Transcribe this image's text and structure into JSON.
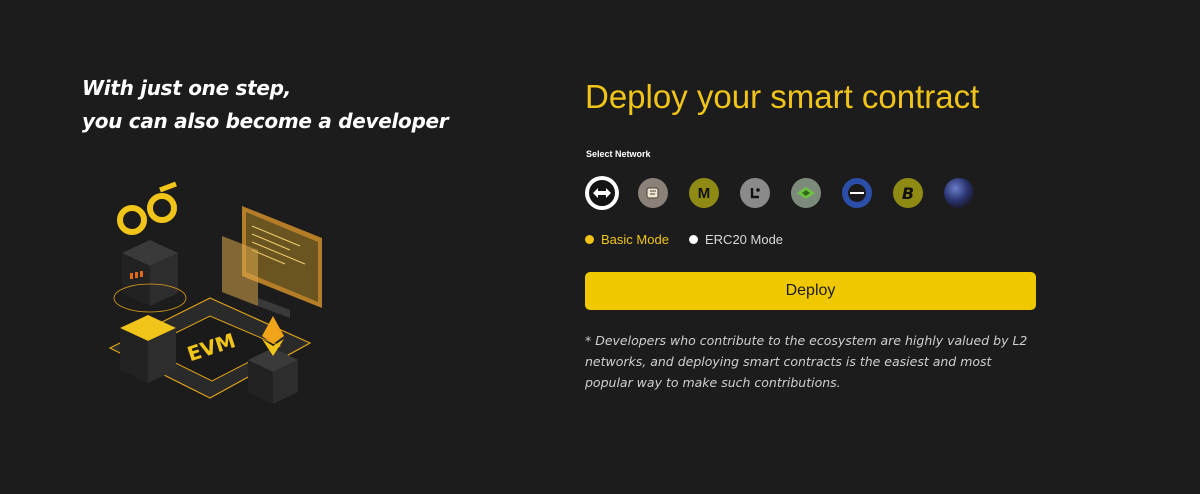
{
  "hero": {
    "line1": "With just one step,",
    "line2": "you can also become a developer",
    "illustration_text": "EVM"
  },
  "form": {
    "title": "Deploy your smart contract",
    "network_label": "Select Network",
    "networks": [
      {
        "icon": "double-arrow-icon",
        "selected": true
      },
      {
        "icon": "scroll-icon",
        "selected": false
      },
      {
        "icon": "m-letter-icon",
        "selected": false
      },
      {
        "icon": "l-letter-icon",
        "selected": false
      },
      {
        "icon": "green-diamond-icon",
        "selected": false
      },
      {
        "icon": "blue-ring-icon",
        "selected": false
      },
      {
        "icon": "b-letter-icon",
        "selected": false
      },
      {
        "icon": "blue-sphere-icon",
        "selected": false
      }
    ],
    "m_glyph": "M",
    "b_glyph": "B",
    "modes": {
      "basic": "Basic Mode",
      "erc20": "ERC20 Mode",
      "selected": "basic"
    },
    "deploy_label": "Deploy",
    "note": "* Developers who contribute to the ecosystem are highly valued by L2 networks, and deploying smart contracts is the easiest and most popular way to make such contributions."
  },
  "colors": {
    "background": "#1c1c1c",
    "accent": "#f0c419",
    "button": "#f0c800"
  }
}
